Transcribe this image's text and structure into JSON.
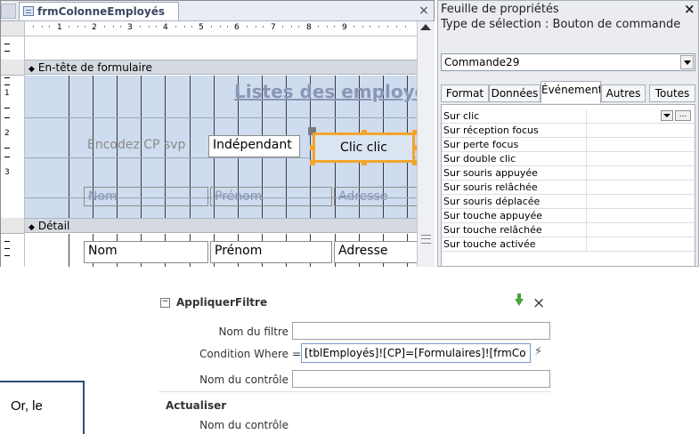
{
  "designer": {
    "tab_title": "frmColonneEmployés",
    "close_glyph": "×",
    "ruler_numbers": [
      "1",
      "2",
      "3",
      "4",
      "5",
      "6",
      "7",
      "8",
      "9"
    ],
    "vruler_numbers": [
      "1",
      "2",
      "3"
    ],
    "header_section": "En-tête de formulaire",
    "detail_section": "Détail",
    "title_label": "Listes des employés e",
    "encodez_label": "Encodez CP svp",
    "independant_box": "Indépendant",
    "button_label": "Clic clic",
    "header_nom": "Nom",
    "header_prenom": "Prénom",
    "header_adresse": "Adresse",
    "detail_nom": "Nom",
    "detail_prenom": "Prénom",
    "detail_adresse": "Adresse"
  },
  "properties": {
    "title": "Feuille de propriétés",
    "close_glyph": "×",
    "selection_type": "Type de sélection :  Bouton de commande",
    "combo_value": "Commande29",
    "tabs": [
      "Format",
      "Données",
      "Événement",
      "Autres",
      "Toutes"
    ],
    "active_tab": "Événement",
    "rows": [
      "Sur clic",
      "Sur réception focus",
      "Sur perte focus",
      "Sur double clic",
      "Sur souris appuyée",
      "Sur souris relâchée",
      "Sur souris déplacée",
      "Sur touche appuyée",
      "Sur touche relâchée",
      "Sur touche activée"
    ],
    "build_glyph": "..."
  },
  "macro": {
    "collapse_glyph": "−",
    "action": "AppliquerFiltre",
    "close_glyph": "×",
    "filter_name_label": "Nom du filtre",
    "filter_name_value": "",
    "where_label": "Condition Where",
    "where_eq": "=",
    "where_value": "[tblEmployés]![CP]=[Formulaires]![frmCo",
    "wand_glyph": "⚡",
    "control_label": "Nom du contrôle",
    "control_value": "",
    "action2": "Actualiser",
    "control_label2": "Nom du contrôle"
  },
  "fragment": {
    "text": "Or, le"
  },
  "colors": {
    "button_border": "#f4a42a",
    "header_background": "#cfdcef",
    "macro_arrow": "#4aa43a"
  }
}
